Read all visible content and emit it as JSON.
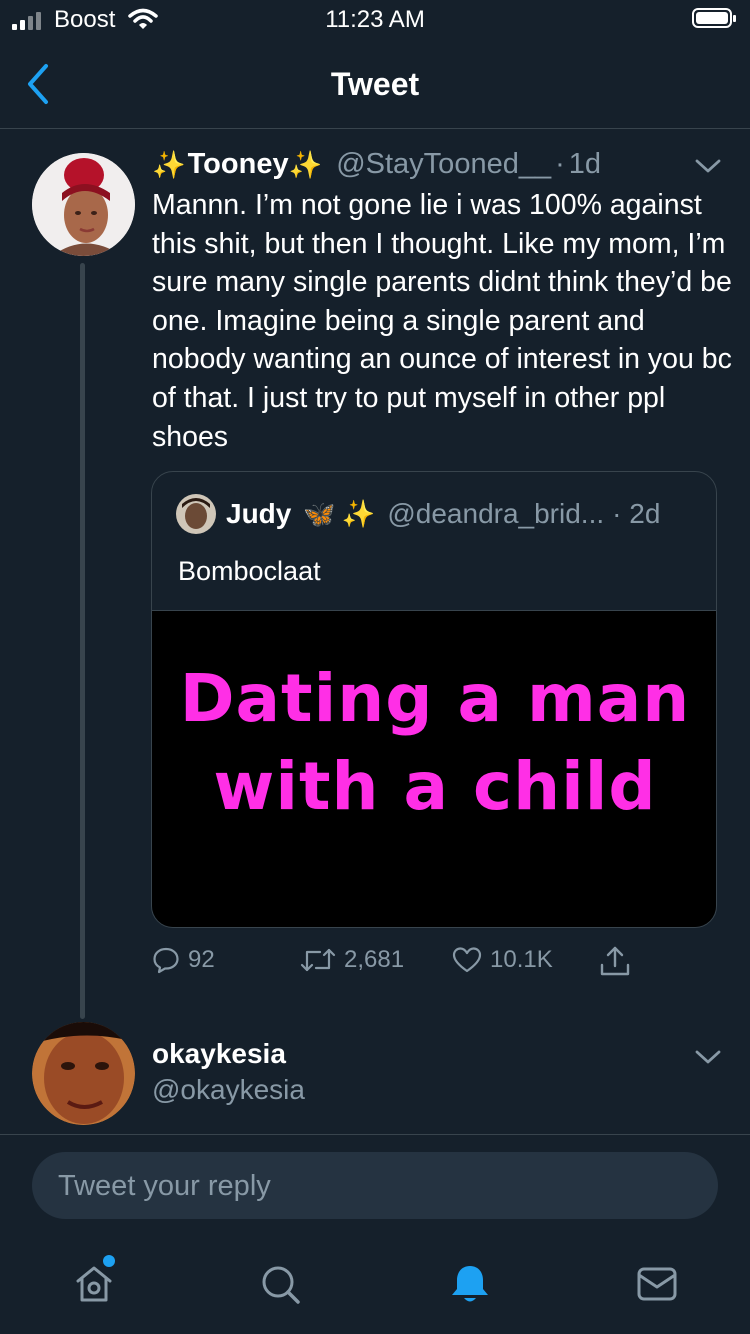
{
  "status_bar": {
    "carrier": "Boost",
    "time": "11:23 AM"
  },
  "nav": {
    "title": "Tweet"
  },
  "tweet": {
    "sparkle_left": "✨",
    "name": "Tooney",
    "sparkle_right": "✨",
    "handle": "@StayTooned__",
    "separator": "·",
    "time": "1d",
    "text": "Mannn. I’m not gone lie i was 100% against this shit, but then I thought. Like my mom, I’m sure many single parents didnt think they’d be one. Imagine being a single parent and nobody wanting an ounce of interest in you bc of that. I just try to put myself in other ppl shoes",
    "quote": {
      "name": "Judy",
      "emoji_1": "🦋",
      "emoji_2": "✨",
      "handle": "@deandra_brid...",
      "time": "· 2d",
      "text": "Bomboclaat",
      "media_line1": "Dating a man",
      "media_line2": "with a child"
    },
    "actions": {
      "replies": "92",
      "retweets": "2,681",
      "likes": "10.1K"
    }
  },
  "reply_user": {
    "name": "okaykesia",
    "handle": "@okaykesia"
  },
  "reply_box": {
    "placeholder": "Tweet your reply"
  },
  "tabs": [
    "home-icon",
    "search-icon",
    "notifications-icon",
    "messages-icon"
  ],
  "colors": {
    "background": "#15202b",
    "accent": "#1da1f2",
    "muted": "#8899a6",
    "divider": "#38444d",
    "media_text": "#ff2fe6"
  }
}
